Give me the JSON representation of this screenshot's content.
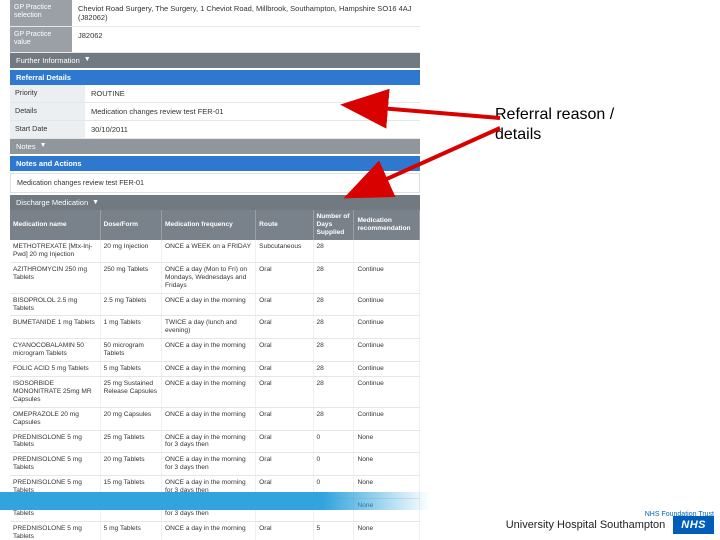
{
  "top": {
    "gp_label1": "GP Practice selection",
    "gp_value1": "Cheviot Road Surgery, The Surgery, 1 Cheviot Road, Millbrook, Southampton, Hampshire SO16 4AJ (J82062)",
    "gp_label2": "GP Practice value",
    "gp_value2": "J82062"
  },
  "sections": {
    "further": "Further Information",
    "notes": "Notes",
    "discharge": "Discharge Medication"
  },
  "referral": {
    "title": "Referral Details",
    "priority_label": "Priority",
    "priority_value": "ROUTINE",
    "details_label": "Details",
    "details_value": "Medication changes review test FER-01",
    "start_label": "Start Date",
    "start_value": "30/10/2011"
  },
  "notes": {
    "title": "Notes and Actions",
    "text": "Medication changes review test FER-01"
  },
  "meds": {
    "headers": {
      "name": "Medication name",
      "dose": "Dose/Form",
      "freq": "Medication frequency",
      "route": "Route",
      "days": "Number of Days Supplied",
      "rec": "Medication recommendation"
    },
    "rows": [
      {
        "name": "METHOTREXATE [Mtx-Inj-Pwd] 20 mg Injection",
        "dose": "20 mg Injection",
        "freq": "ONCE a WEEK on a FRIDAY",
        "route": "Subcutaneous",
        "days": "28",
        "rec": ""
      },
      {
        "name": "AZITHROMYCIN 250 mg Tablets",
        "dose": "250 mg Tablets",
        "freq": "ONCE a day (Mon to Fri) on Mondays, Wednesdays and Fridays",
        "route": "Oral",
        "days": "28",
        "rec": "Continue"
      },
      {
        "name": "BISOPROLOL 2.5 mg Tablets",
        "dose": "2.5 mg Tablets",
        "freq": "ONCE a day in the morning",
        "route": "Oral",
        "days": "28",
        "rec": "Continue"
      },
      {
        "name": "BUMETANIDE 1 mg Tablets",
        "dose": "1 mg Tablets",
        "freq": "TWICE a day (lunch and evening)",
        "route": "Oral",
        "days": "28",
        "rec": "Continue"
      },
      {
        "name": "CYANOCOBALAMIN 50 microgram Tablets",
        "dose": "50 microgram Tablets",
        "freq": "ONCE a day in the morning",
        "route": "Oral",
        "days": "28",
        "rec": "Continue"
      },
      {
        "name": "FOLIC ACID 5 mg Tablets",
        "dose": "5 mg Tablets",
        "freq": "ONCE a day in the morning",
        "route": "Oral",
        "days": "28",
        "rec": "Continue"
      },
      {
        "name": "ISOSORBIDE MONONITRATE 25mg MR Capsules",
        "dose": "25 mg Sustained Release Capsules",
        "freq": "ONCE a day in the morning",
        "route": "Oral",
        "days": "28",
        "rec": "Continue"
      },
      {
        "name": "OMEPRAZOLE 20 mg Capsules",
        "dose": "20 mg Capsules",
        "freq": "ONCE a day in the morning",
        "route": "Oral",
        "days": "28",
        "rec": "Continue"
      },
      {
        "name": "PREDNISOLONE 5 mg Tablets",
        "dose": "25 mg Tablets",
        "freq": "ONCE a day in the morning for 3 days then",
        "route": "Oral",
        "days": "0",
        "rec": "None"
      },
      {
        "name": "PREDNISOLONE 5 mg Tablets",
        "dose": "20 mg Tablets",
        "freq": "ONCE a day in the morning for 3 days then",
        "route": "Oral",
        "days": "0",
        "rec": "None"
      },
      {
        "name": "PREDNISOLONE 5 mg Tablets",
        "dose": "15 mg Tablets",
        "freq": "ONCE a day in the morning for 3 days then",
        "route": "Oral",
        "days": "0",
        "rec": "None"
      },
      {
        "name": "PREDNISOLONE 5 mg Tablets",
        "dose": "10 mg Tablets",
        "freq": "ONCE a day in the morning for 3 days then",
        "route": "Oral",
        "days": "0",
        "rec": "None"
      },
      {
        "name": "PREDNISOLONE 5 mg Tablets",
        "dose": "5 mg Tablets",
        "freq": "ONCE a day in the morning",
        "route": "Oral",
        "days": "5",
        "rec": "None"
      }
    ]
  },
  "annotation": {
    "line1": "Referral reason /",
    "line2": "details"
  },
  "footer": {
    "uhs": "University Hospital Southampton",
    "nhs": "NHS",
    "trust": "NHS Foundation Trust"
  }
}
